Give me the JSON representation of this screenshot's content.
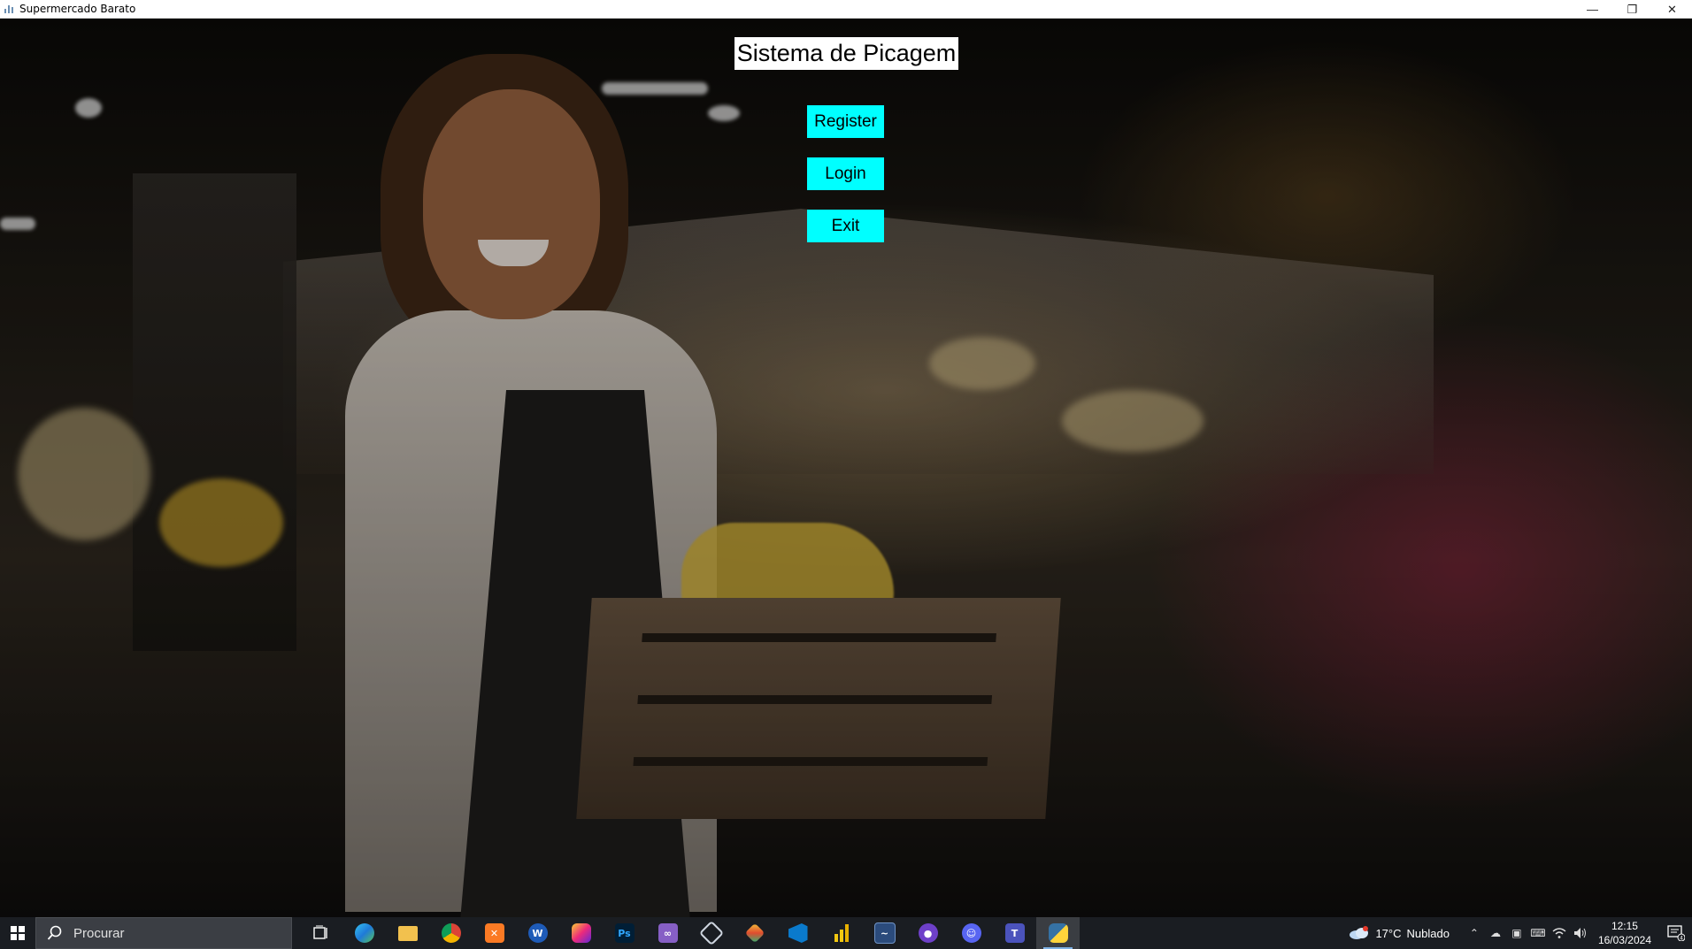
{
  "window": {
    "title": "Supermercado Barato",
    "minimize_symbol": "—",
    "restore_symbol": "❐",
    "close_symbol": "✕"
  },
  "app": {
    "heading": "Sistema de Picagem",
    "buttons": {
      "register": "Register",
      "login": "Login",
      "exit": "Exit"
    },
    "colors": {
      "button_bg": "#00ffff",
      "heading_bg": "#ffffff"
    }
  },
  "taskbar": {
    "search_placeholder": "Procurar",
    "pinned_apps": [
      {
        "icon": "task-view-icon"
      },
      {
        "icon": "edge-icon"
      },
      {
        "icon": "file-explorer-icon"
      },
      {
        "icon": "chrome-icon"
      },
      {
        "icon": "xampp-icon"
      },
      {
        "icon": "word-like-icon"
      },
      {
        "icon": "instagram-icon"
      },
      {
        "icon": "photoshop-icon"
      },
      {
        "icon": "visual-studio-icon"
      },
      {
        "icon": "virtualbox-icon"
      },
      {
        "icon": "git-icon"
      },
      {
        "icon": "vscode-icon"
      },
      {
        "icon": "power-bi-icon"
      },
      {
        "icon": "wireshark-icon"
      },
      {
        "icon": "github-icon"
      },
      {
        "icon": "discord-icon"
      },
      {
        "icon": "teams-icon"
      },
      {
        "icon": "python-icon"
      }
    ],
    "weather": {
      "temperature": "17°C",
      "condition": "Nublado"
    },
    "clock": {
      "time": "12:15",
      "date": "16/03/2024"
    },
    "notification_count": "4"
  }
}
